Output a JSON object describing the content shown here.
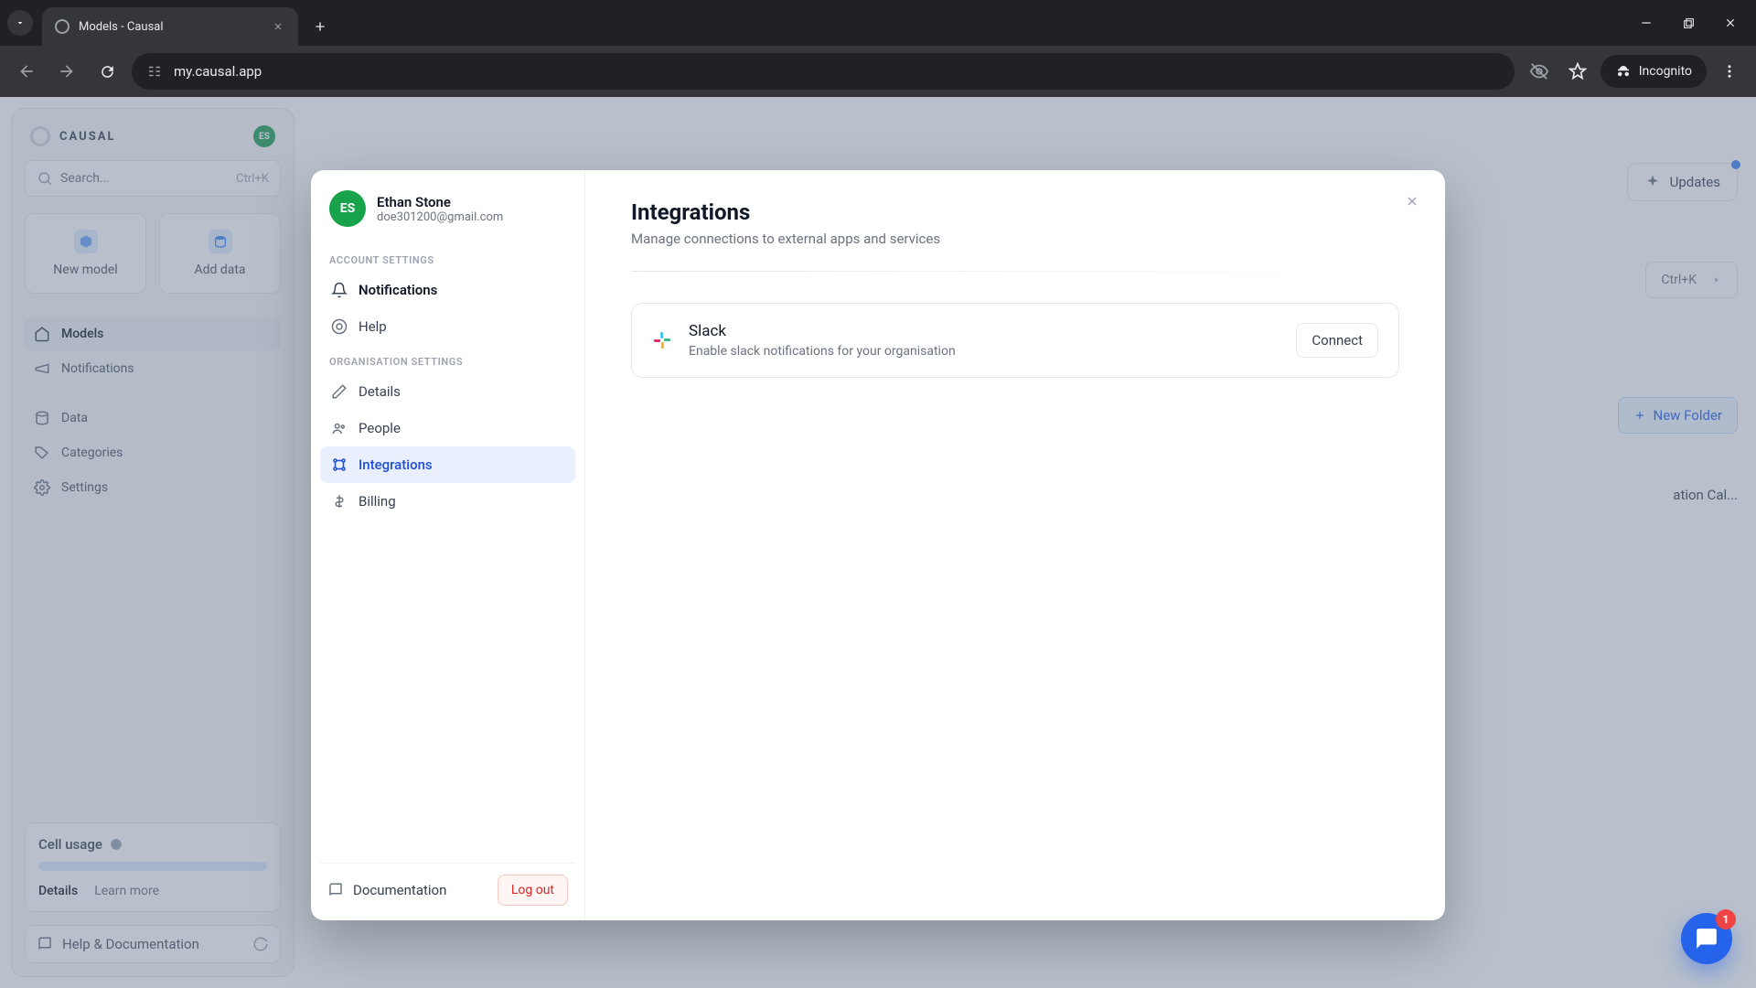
{
  "browser": {
    "tab_title": "Models - Causal",
    "url": "my.causal.app",
    "incognito_label": "Incognito"
  },
  "app": {
    "brand": "CAUSAL",
    "avatar_initials": "ES",
    "search_placeholder": "Search...",
    "search_kbd": "Ctrl+K",
    "tiles": {
      "new_model": "New model",
      "add_data": "Add data"
    },
    "nav": {
      "models": "Models",
      "notifications": "Notifications",
      "data": "Data",
      "categories": "Categories",
      "settings": "Settings"
    },
    "cell_usage": {
      "title": "Cell usage",
      "details": "Details",
      "learn_more": "Learn more"
    },
    "help_doc": "Help & Documentation",
    "updates": "Updates",
    "kbd_hint": "Ctrl+K",
    "new_folder": "New Folder",
    "truncated_item": "ation Cal..."
  },
  "dialog": {
    "user": {
      "name": "Ethan Stone",
      "email": "doe301200@gmail.com",
      "initials": "ES"
    },
    "sections": {
      "account_label": "ACCOUNT SETTINGS",
      "org_label": "ORGANISATION SETTINGS"
    },
    "items": {
      "notifications": "Notifications",
      "help": "Help",
      "details": "Details",
      "people": "People",
      "integrations": "Integrations",
      "billing": "Billing"
    },
    "footer": {
      "documentation": "Documentation",
      "logout": "Log out"
    },
    "main": {
      "title": "Integrations",
      "subtitle": "Manage connections to external apps and services",
      "slack": {
        "name": "Slack",
        "desc": "Enable slack notifications for your organisation",
        "connect": "Connect"
      }
    }
  },
  "chat_badge": "1"
}
